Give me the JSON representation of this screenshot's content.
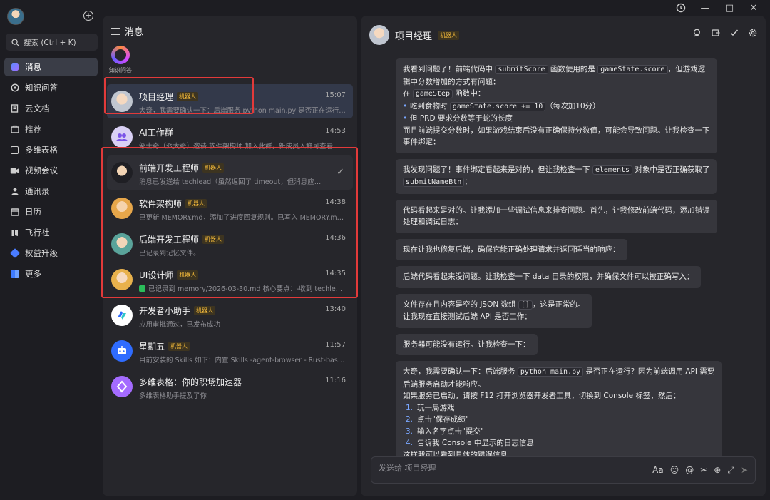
{
  "window": {
    "history_icon": "history-icon",
    "min": "—",
    "max": "□",
    "close": "✕"
  },
  "nav": {
    "search_label": "搜索 (Ctrl + K)",
    "plus": "+",
    "items": [
      {
        "label": "消息",
        "icon": "message-icon",
        "active": true
      },
      {
        "label": "知识问答",
        "icon": "qa-icon"
      },
      {
        "label": "云文档",
        "icon": "doc-icon"
      },
      {
        "label": "推荐",
        "icon": "recommend-icon"
      },
      {
        "label": "多维表格",
        "icon": "table-icon"
      },
      {
        "label": "视频会议",
        "icon": "video-icon"
      },
      {
        "label": "通讯录",
        "icon": "contacts-icon"
      },
      {
        "label": "日历",
        "icon": "calendar-icon"
      },
      {
        "label": "飞行社",
        "icon": "community-icon"
      },
      {
        "label": "权益升级",
        "icon": "upgrade-icon"
      },
      {
        "label": "更多",
        "icon": "more-icon"
      }
    ]
  },
  "messages_panel": {
    "title": "消息",
    "knowledge_label": "知识问答",
    "conversations": [
      {
        "name": "项目经理",
        "badge": "机器人",
        "time": "15:07",
        "preview": "大奇，我需要确认一下：后端服务 python main.py 是否正在运行？..."
      },
      {
        "name": "AI工作群",
        "badge": "",
        "time": "14:53",
        "preview": "邹士奇（派大奇）邀请 软件架构师 加入此群，新成员入群可查看..."
      },
      {
        "name": "前端开发工程师",
        "badge": "机器人",
        "time": "",
        "preview": "消息已发送给 techlead（虽然返回了 timeout，但消息应该已送..."
      },
      {
        "name": "软件架构师",
        "badge": "机器人",
        "time": "14:38",
        "preview": "已更新 MEMORY.md，添加了进度回复规则。已写入 MEMORY.md。..."
      },
      {
        "name": "后端开发工程师",
        "badge": "机器人",
        "time": "14:36",
        "preview": "已记录到记忆文件。"
      },
      {
        "name": "UI设计师",
        "badge": "机器人",
        "time": "14:35",
        "preview": "已记录到 memory/2026-03-30.md 核心要点：-收到 techlead ..."
      },
      {
        "name": "开发者小助手",
        "badge": "机器人",
        "time": "13:40",
        "preview": "应用审批通过，已发布成功"
      },
      {
        "name": "星期五",
        "badge": "机器人",
        "time": "11:57",
        "preview": "目前安装的 Skills 如下：内置 Skills -agent-browser - Rust-based ..."
      },
      {
        "name": "多维表格：你的职场加速器",
        "badge": "",
        "time": "11:16",
        "preview": "多维表格助手提及了你"
      }
    ]
  },
  "chat": {
    "title": "项目经理",
    "badge": "机器人",
    "messages": {
      "m1_l1a": "我看到问题了！前端代码中 ",
      "m1_c1": "submitScore",
      "m1_l1b": " 函数使用的是 ",
      "m1_c2": "gameState.score",
      "m1_l1c": "，但游戏逻",
      "m1_l2": "辑中分数增加的方式有问题：",
      "m1_l3a": "在 ",
      "m1_c3": "gameStep",
      "m1_l3b": " 函数中：",
      "m1_li1a": "吃到食物时 ",
      "m1_c4": "gameState.score += 10",
      "m1_li1b": "（每次加10分）",
      "m1_li2": "但 PRD 要求分数等于蛇的长度",
      "m1_l4": "而且前端提交分数时，如果游戏结束后没有正确保持分数值，可能会导致问题。让我检查一下",
      "m1_l5": "事件绑定：",
      "m2_a": "我发现问题了！事件绑定看起来是对的，但让我检查一下 ",
      "m2_c1": "elements",
      "m2_b": " 对象中是否正确获取了",
      "m2_c2": "submitNameBtn",
      "m2_c": "：",
      "m3_l1": "代码看起来是对的。让我添加一些调试信息来排查问题。首先，让我修改前端代码，添加错误",
      "m3_l2": "处理和调试日志：",
      "m4": "现在让我也修复后端，确保它能正确处理请求并返回适当的响应：",
      "m5": "后端代码看起来没问题。让我检查一下 data 目录的权限，并确保文件可以被正确写入：",
      "m6_l1a": "文件存在且内容是空的 JSON 数组 ",
      "m6_c1": "[]",
      "m6_l1b": "，这是正常的。",
      "m6_l2": "让我现在直接测试后端 API 是否工作：",
      "m7": "服务器可能没有运行。让我检查一下：",
      "m8_l1a": "大奇，我需要确认一下：后端服务 ",
      "m8_c1": "python main.py",
      "m8_l1b": " 是否正在运行？因为前端调用 API 需要",
      "m8_l2": "后端服务启动才能响应。",
      "m8_l3": "如果服务已启动，请按 F12 打开浏览器开发者工具，切换到 Console 标签，然后：",
      "m8_o1": "玩一局游戏",
      "m8_o2": "点击\"保存成绩\"",
      "m8_o3": "输入名字点击\"提交\"",
      "m8_o4": "告诉我 Console 中显示的日志信息",
      "m8_l4": "这样我可以看到具体的错误信息。",
      "n1": "1.",
      "n2": "2.",
      "n3": "3.",
      "n4": "4."
    },
    "input_placeholder": "发送给 项目经理"
  }
}
